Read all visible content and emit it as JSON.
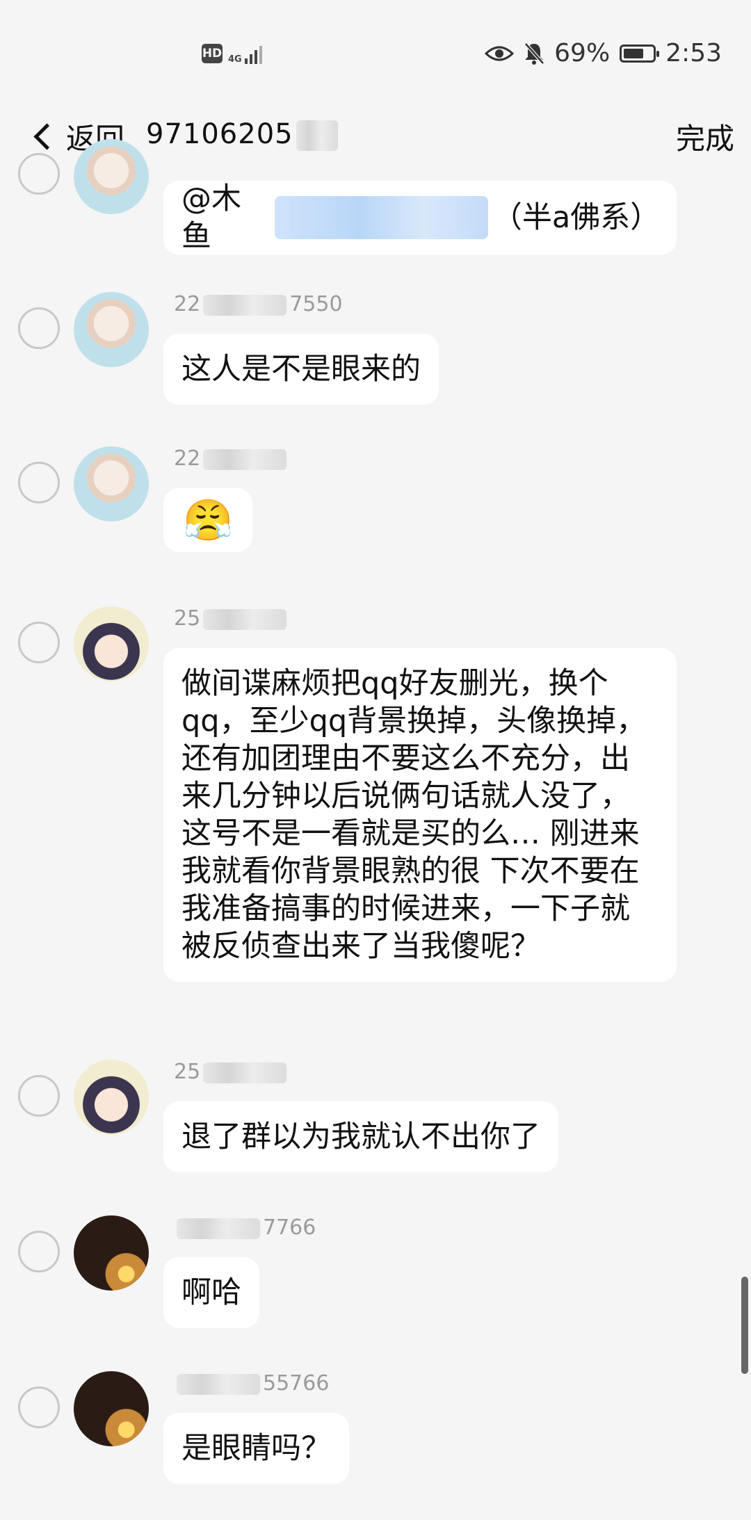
{
  "status_bar": {
    "hd": "HD",
    "network": "4G",
    "battery": "69%",
    "battery_level": 0.69,
    "time": "2:53"
  },
  "nav": {
    "back_label": "返回",
    "title": "97106205",
    "done_label": "完成"
  },
  "messages": [
    {
      "sender": "",
      "text": "@木鱼",
      "text_suffix": "（半a佛系）"
    },
    {
      "sender_prefix": "22",
      "sender_suffix": "7550",
      "text": "这人是不是眼来的"
    },
    {
      "sender_prefix": "22",
      "sender_suffix": "",
      "text": "😤"
    },
    {
      "sender_prefix": "25",
      "sender_suffix": "",
      "text": "做间谍麻烦把qq好友删光，换个qq，至少qq背景换掉，头像换掉，还有加团理由不要这么不充分，出来几分钟以后说俩句话就人没了，这号不是一看就是买的么… 刚进来我就看你背景眼熟的很 下次不要在我准备搞事的时候进来，一下子就被反侦查出来了当我傻呢？"
    },
    {
      "sender_prefix": "25",
      "sender_suffix": "",
      "text": "退了群以为我就认不出你了"
    },
    {
      "sender_prefix": "",
      "sender_suffix": "7766",
      "text": "啊哈"
    },
    {
      "sender_prefix": "",
      "sender_suffix": "55766",
      "text": "是眼睛吗？"
    }
  ]
}
